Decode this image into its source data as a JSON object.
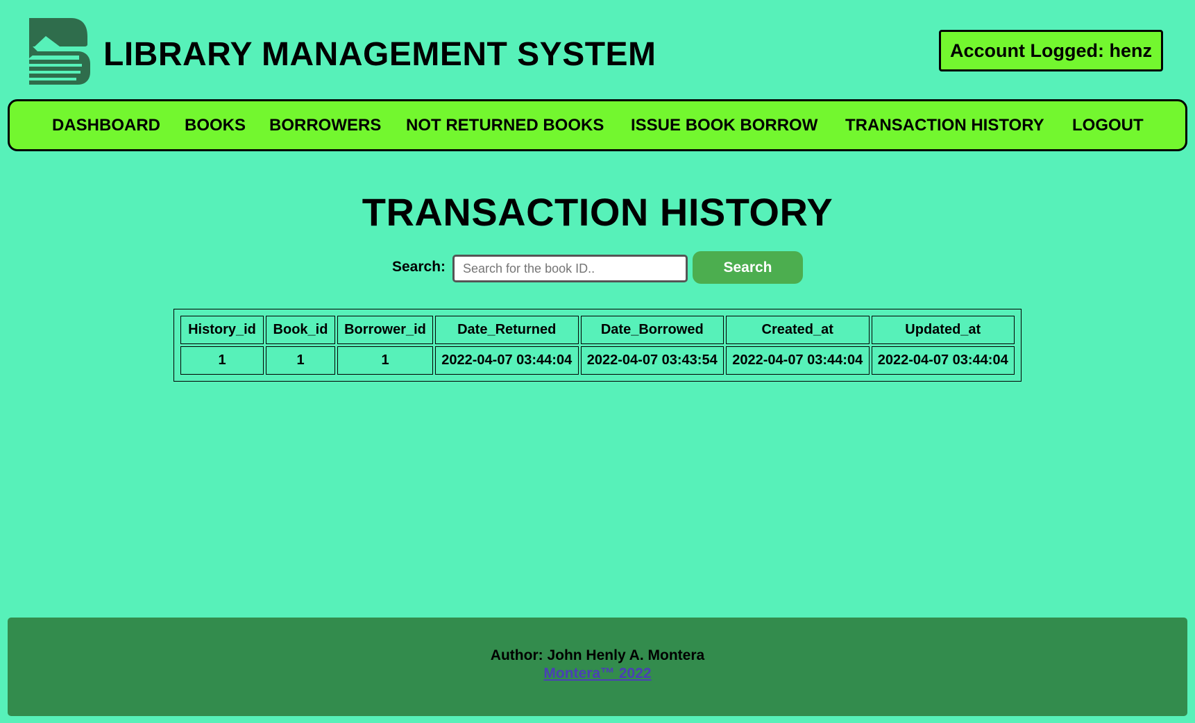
{
  "header": {
    "title": "LIBRARY MANAGEMENT SYSTEM",
    "account": "Account Logged: henz",
    "logo_icon": "book-stack-logo-icon"
  },
  "nav": {
    "items": [
      {
        "label": "DASHBOARD"
      },
      {
        "label": "BOOKS"
      },
      {
        "label": "BORROWERS"
      },
      {
        "label": "NOT RETURNED BOOKS"
      },
      {
        "label": "ISSUE BOOK BORROW"
      },
      {
        "label": "TRANSACTION HISTORY"
      },
      {
        "label": "LOGOUT"
      }
    ]
  },
  "main": {
    "heading": "TRANSACTION HISTORY",
    "search_label": "Search:",
    "search_placeholder": "Search for the book ID..",
    "search_value": "",
    "search_button": "Search"
  },
  "table": {
    "columns": [
      "History_id",
      "Book_id",
      "Borrower_id",
      "Date_Returned",
      "Date_Borrowed",
      "Created_at",
      "Updated_at"
    ],
    "rows": [
      [
        "1",
        "1",
        "1",
        "2022-04-07 03:44:04",
        "2022-04-07 03:43:54",
        "2022-04-07 03:44:04",
        "2022-04-07 03:44:04"
      ]
    ]
  },
  "footer": {
    "author": "Author: John Henly A. Montera",
    "link": "Montera™ 2022"
  },
  "colors": {
    "page_bg": "#57f1b9",
    "nav_bg": "#73f72f",
    "button_bg": "#4cae4f",
    "footer_bg": "#338c4d",
    "link": "#4b3fb5",
    "logo": "#2f6d4c"
  }
}
